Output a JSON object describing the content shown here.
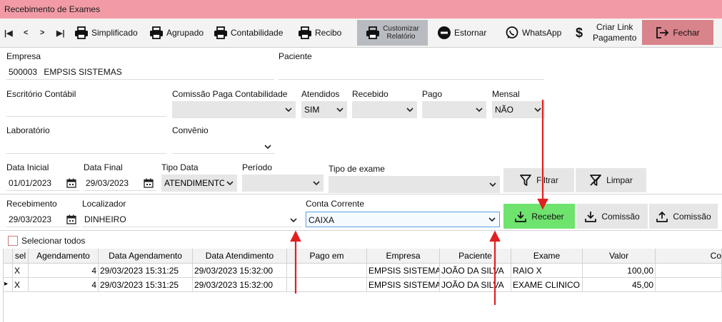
{
  "window": {
    "title": "Recebimento de Exames"
  },
  "nav": {
    "first": "|◀",
    "prev": "<",
    "next": ">",
    "last": "▶|"
  },
  "toolbar": {
    "simplificado": "Simplificado",
    "agrupado": "Agrupado",
    "contabilidade": "Contabilidade",
    "recibo": "Recibo",
    "customizar_line1": "Customizar",
    "customizar_line2": "Relatório",
    "estornar": "Estornar",
    "whatsapp": "WhatsApp",
    "criar_link_line1": "Criar Link",
    "criar_link_line2": "Pagamento",
    "fechar": "Fechar"
  },
  "filters": {
    "empresa_label": "Empresa",
    "empresa_code": "500003",
    "empresa_name": "EMPSIS SISTEMAS",
    "paciente_label": "Paciente",
    "paciente_value": "",
    "escritorio_label": "Escritório Contábil",
    "comissao_label": "Comissão Paga Contabilidade",
    "comissao_value": "",
    "atendidos_label": "Atendidos",
    "atendidos_value": "SIM",
    "recebido_label": "Recebido",
    "recebido_value": "",
    "pago_label": "Pago",
    "pago_value": "",
    "mensal_label": "Mensal",
    "mensal_value": "NÃO",
    "laboratorio_label": "Laboratório",
    "convenio_label": "Convênio",
    "data_inicial_label": "Data Inicial",
    "data_inicial_value": "01/01/2023",
    "data_final_label": "Data Final",
    "data_final_value": "29/03/2023",
    "tipo_data_label": "Tipo Data",
    "tipo_data_value": "ATENDIMENTO",
    "periodo_label": "Período",
    "tipo_exame_label": "Tipo de exame",
    "filtrar": "Filtrar",
    "limpar": "Limpar"
  },
  "receipt": {
    "recebimento_label": "Recebimento",
    "recebimento_value": "29/03/2023",
    "localizador_label": "Localizador",
    "localizador_value": "DINHEIRO",
    "conta_label": "Conta Corrente",
    "conta_value": "CAIXA",
    "receber": "Receber",
    "comissao1": "Comissão",
    "comissao2": "Comissão",
    "receber_color": "#6ee36e"
  },
  "selecionar_todos": "Selecionar todos",
  "grid": {
    "headers": [
      "sel",
      "Agendamento",
      "Data Agendamento",
      "Data Atendimento",
      "Pago em",
      "Empresa",
      "Paciente",
      "Exame",
      "Valor",
      "Co"
    ],
    "rows": [
      {
        "indicator": "",
        "sel": "X",
        "agendamento": "4",
        "data_agendamento": "29/03/2023 15:31:25",
        "data_atendimento": "29/03/2023 15:32:00",
        "pago_em": "",
        "empresa": "EMPSIS SISTEMAS",
        "paciente": "JOÃO DA SILVA",
        "exame": "RAIO X",
        "valor": "100,00"
      },
      {
        "indicator": "▸",
        "sel": "X",
        "agendamento": "4",
        "data_agendamento": "29/03/2023 15:31:25",
        "data_atendimento": "29/03/2023 15:32:00",
        "pago_em": "",
        "empresa": "EMPSIS SISTEMAS",
        "paciente": "JOÃO DA SILVA",
        "exame": "EXAME CLINICO GERAL",
        "valor": "45,00"
      }
    ]
  },
  "colors": {
    "titlebar": "#f29ba7",
    "close_button": "#d9838b",
    "annotation_arrow": "#e02020"
  }
}
